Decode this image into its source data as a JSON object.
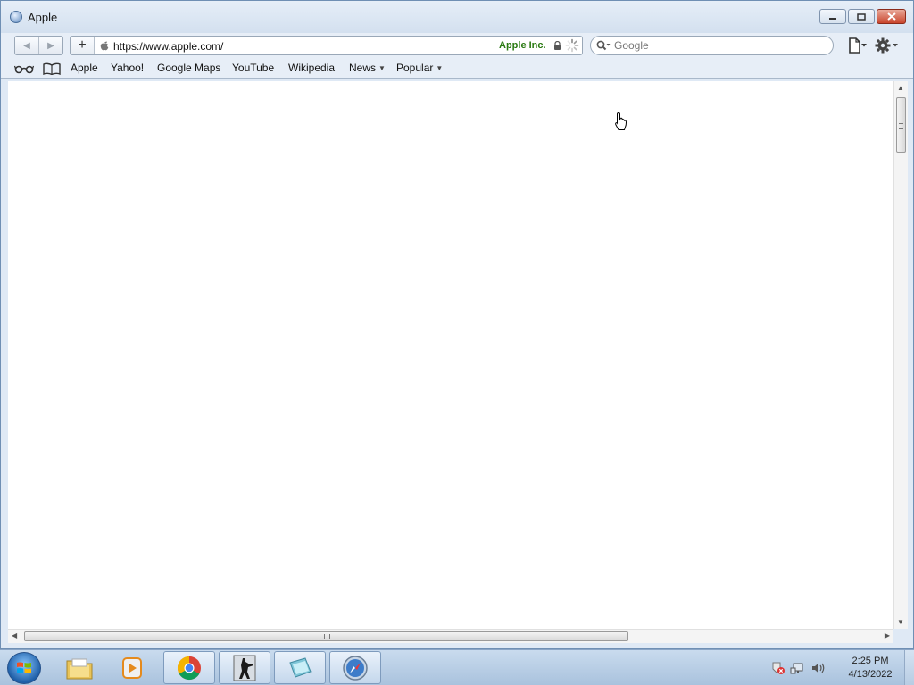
{
  "window": {
    "title": "Apple"
  },
  "toolbar": {
    "back_label": "◀",
    "forward_label": "▶",
    "add_bookmark_label": "+",
    "url": "https://www.apple.com/",
    "cert_owner": "Apple Inc.",
    "search_placeholder": "Google"
  },
  "bookmarks": {
    "items": [
      {
        "label": "Apple"
      },
      {
        "label": "Yahoo!"
      },
      {
        "label": "Google Maps"
      },
      {
        "label": "YouTube"
      },
      {
        "label": "Wikipedia"
      },
      {
        "label": "News",
        "has_menu": true
      },
      {
        "label": "Popular",
        "has_menu": true
      }
    ]
  },
  "taskbar": {
    "apps": [
      {
        "name": "Windows Explorer",
        "icon": "folder-icon"
      },
      {
        "name": "Windows Media Player",
        "icon": "media-player-icon"
      },
      {
        "name": "Google Chrome",
        "icon": "chrome-icon"
      },
      {
        "name": "Counter-Strike",
        "icon": "counter-strike-icon"
      },
      {
        "name": "Notepad",
        "icon": "notepad-icon"
      },
      {
        "name": "Safari",
        "icon": "safari-icon",
        "active": true
      }
    ],
    "clock_time": "2:25 PM",
    "clock_date": "4/13/2022"
  },
  "colors": {
    "cert_green": "#2a7a12",
    "window_frame": "#dfe9f5",
    "close_red": "#c9452c"
  }
}
